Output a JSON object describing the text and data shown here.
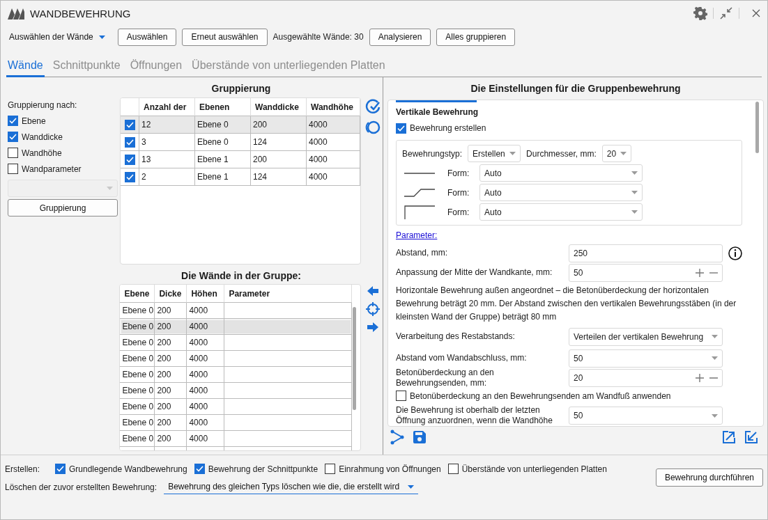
{
  "window": {
    "title": "WANDBEWEHRUNG"
  },
  "toolbar": [
    {
      "kind": "dropdown",
      "label": "Auswählen der Wände"
    },
    {
      "kind": "button",
      "label": "Auswählen"
    },
    {
      "kind": "button",
      "label": "Erneut auswählen"
    },
    {
      "kind": "text",
      "label": "Ausgewählte Wände: 30"
    },
    {
      "kind": "button",
      "label": "Analysieren"
    },
    {
      "kind": "button",
      "label": "Alles gruppieren"
    }
  ],
  "tabs": [
    {
      "label": "Wände",
      "selected": true
    },
    {
      "label": "Schnittpunkte",
      "selected": false
    },
    {
      "label": "Öffnungen",
      "selected": false
    },
    {
      "label": "Überstände von unterliegenden Platten",
      "selected": false
    }
  ],
  "grouping": {
    "title": "Gruppierung",
    "by_label": "Gruppierung nach:",
    "options": [
      {
        "label": "Ebene",
        "checked": true
      },
      {
        "label": "Wanddicke",
        "checked": true
      },
      {
        "label": "Wandhöhe",
        "checked": false
      },
      {
        "label": "Wandparameter",
        "checked": false
      }
    ],
    "parameter_combo": {
      "disabled": true
    },
    "button": "Gruppierung"
  },
  "group_table": {
    "columns": [
      "Anzahl der",
      "Ebenen",
      "Wanddicke",
      "Wandhöhe"
    ],
    "rows": [
      {
        "checked": true,
        "selected": true,
        "cells": [
          "12",
          "Ebene 0",
          "200",
          "4000"
        ]
      },
      {
        "checked": true,
        "selected": false,
        "cells": [
          "3",
          "Ebene 0",
          "124",
          "4000"
        ]
      },
      {
        "checked": true,
        "selected": false,
        "cells": [
          "13",
          "Ebene 1",
          "200",
          "4000"
        ]
      },
      {
        "checked": true,
        "selected": false,
        "cells": [
          "2",
          "Ebene 1",
          "124",
          "4000"
        ]
      }
    ]
  },
  "walls_title": "Die Wände in der Gruppe:",
  "walls_table": {
    "columns": [
      "Ebene",
      "Dicke",
      "Höhen",
      "Parameter"
    ],
    "rows": [
      {
        "selected": false,
        "cells": [
          "Ebene 0",
          "200",
          "4000",
          ""
        ]
      },
      {
        "selected": true,
        "cells": [
          "Ebene 0",
          "200",
          "4000",
          ""
        ]
      },
      {
        "selected": false,
        "cells": [
          "Ebene 0",
          "200",
          "4000",
          ""
        ]
      },
      {
        "selected": false,
        "cells": [
          "Ebene 0",
          "200",
          "4000",
          ""
        ]
      },
      {
        "selected": false,
        "cells": [
          "Ebene 0",
          "200",
          "4000",
          ""
        ]
      },
      {
        "selected": false,
        "cells": [
          "Ebene 0",
          "200",
          "4000",
          ""
        ]
      },
      {
        "selected": false,
        "cells": [
          "Ebene 0",
          "200",
          "4000",
          ""
        ]
      },
      {
        "selected": false,
        "cells": [
          "Ebene 0",
          "200",
          "4000",
          ""
        ]
      },
      {
        "selected": false,
        "cells": [
          "Ebene 0",
          "200",
          "4000",
          ""
        ]
      }
    ]
  },
  "settings": {
    "title": "Die Einstellungen für die Gruppenbewehrung",
    "section": "Vertikale Bewehrung",
    "create": {
      "label": "Bewehrung erstellen",
      "checked": true
    },
    "type_label": "Bewehrungstyp:",
    "type_value": "Erstellen",
    "diameter_label": "Durchmesser, mm:",
    "diameter_value": "20",
    "forms": [
      {
        "kind": "straight",
        "label": "Form:",
        "value": "Auto"
      },
      {
        "kind": "crank",
        "label": "Form:",
        "value": "Auto"
      },
      {
        "kind": "hook",
        "label": "Form:",
        "value": "Auto"
      }
    ],
    "params_link": "Parameter:",
    "fields": [
      {
        "kind": "input",
        "label": "Abstand, mm:",
        "value": "250",
        "info": true
      },
      {
        "kind": "stepper",
        "label": "Anpassung der Mitte der Wandkante, mm:",
        "value": "50"
      },
      {
        "kind": "note",
        "label": "Horizontale Bewehrung außen angeordnet – die Betonüberdeckung der horizontalen Bewehrung beträgt 20 mm. Der Abstand zwischen den vertikalen Bewehrungsstäben (in der kleinsten Wand der Gruppe) beträgt 80 mm"
      },
      {
        "kind": "dropdown",
        "label": "Verarbeitung des Restabstands:",
        "value": "Verteilen der vertikalen Bewehrung"
      },
      {
        "kind": "dropdown",
        "label": "Abstand vom Wandabschluss, mm:",
        "value": "50"
      },
      {
        "kind": "stepper",
        "label": "Betonüberdeckung an den Bewehrungsenden, mm:",
        "value": "20"
      },
      {
        "kind": "checkbox",
        "label": "Betonüberdeckung an den Bewehrungsenden am Wandfuß anwenden",
        "checked": false
      },
      {
        "kind": "dropdown",
        "label": "Die Bewehrung ist oberhalb der letzten Öffnung anzuordnen, wenn die Wandhöhe",
        "value": "50"
      }
    ]
  },
  "footer": {
    "create_label": "Erstellen:",
    "create_options": [
      {
        "label": "Grundlegende Wandbewehrung",
        "checked": true
      },
      {
        "label": "Bewehrung der Schnittpunkte",
        "checked": true
      },
      {
        "label": "Einrahmung von Öffnungen",
        "checked": false
      },
      {
        "label": "Überstände von unterliegenden Platten",
        "checked": false
      }
    ],
    "delete_label": "Löschen der zuvor erstellten Bewehrung:",
    "delete_value": "Bewehrung des gleichen Typs löschen wie die, die erstellt wird",
    "run_button": "Bewehrung durchführen"
  }
}
